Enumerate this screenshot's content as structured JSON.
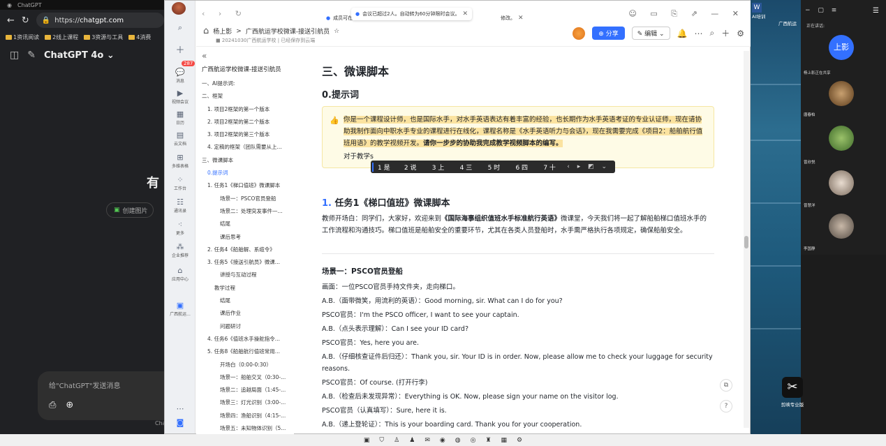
{
  "browser": {
    "tab_title": "ChatGPT",
    "url_prefix": "https://",
    "url_host": "chatgpt.com",
    "bookmarks": [
      "1资讯阅读",
      "2线上课程",
      "3资源与工具",
      "4消费"
    ],
    "model_label": "ChatGPT 4o",
    "hero_partial": "有",
    "create_image": "创建图片",
    "input_placeholder": "给\"ChatGPT\"发送消息",
    "footer_partial": "Cha"
  },
  "rail": {
    "badge": "287",
    "items": [
      "消息",
      "视频会议",
      "日历",
      "云文档",
      "多维表格",
      "工作台",
      "通讯录",
      "更多",
      "企业推荐",
      "应用中心",
      "广西航运..."
    ]
  },
  "doc": {
    "tabs": [
      {
        "label": "成员可在"
      },
      {
        "label": "会议已超过2人。自动转为60分钟限时会议。"
      },
      {
        "label": "修改。"
      }
    ],
    "breadcrumb_root": "杨上影",
    "breadcrumb_sep": ">",
    "title": "广西航运学校微课-接送引航员",
    "sub_folder": "20241030广西航运学校",
    "sub_status": "已经保存到云端",
    "share_label": "分享",
    "edit_label": "编辑"
  },
  "outline": {
    "title": "广西航运学校微课-接送引航员",
    "items": [
      {
        "label": "一、AI提示词:",
        "level": "l1"
      },
      {
        "label": "二、框架",
        "level": "l1"
      },
      {
        "label": "1. 项目2框架的第一个版本",
        "level": "l2"
      },
      {
        "label": "2. 项目2框架的第二个版本",
        "level": "l2"
      },
      {
        "label": "3. 项目2框架的第三个版本",
        "level": "l2"
      },
      {
        "label": "4. 定稿的框架（团队需要从上...",
        "level": "l2"
      },
      {
        "label": "三、微课脚本",
        "level": "l1"
      },
      {
        "label": "0.提示词",
        "level": "l2 act"
      },
      {
        "label": "1. 任务1《梯口值班》微课脚本",
        "level": "l2"
      },
      {
        "label": "场景一：PSCO官员登船",
        "level": "l3"
      },
      {
        "label": "场景二：处理突发事件—...",
        "level": "l3"
      },
      {
        "label": "结尾",
        "level": "l3"
      },
      {
        "label": "课后思考",
        "level": "l3"
      },
      {
        "label": "2. 任务4《船舶解、系缆令》",
        "level": "l2"
      },
      {
        "label": "3. 任务5《接送引航员》微课...",
        "level": "l2"
      },
      {
        "label": "讲授与互动过程",
        "level": "l3"
      },
      {
        "label": "教学过程",
        "level": "l3b"
      },
      {
        "label": "结尾",
        "level": "l3"
      },
      {
        "label": "课后作业",
        "level": "l3"
      },
      {
        "label": "问题研讨",
        "level": "l3"
      },
      {
        "label": "4. 任务6《值班水手操舵指令...",
        "level": "l2"
      },
      {
        "label": "5. 任务8《船舶航行值班常用...",
        "level": "l2"
      },
      {
        "label": "开场白（0:00-0:30）",
        "level": "l3"
      },
      {
        "label": "场景一：船舶交叉（0:30-...",
        "level": "l3"
      },
      {
        "label": "场景二：追越局面（1:45-...",
        "level": "l3"
      },
      {
        "label": "场景三：灯光识别（3:00-...",
        "level": "l3"
      },
      {
        "label": "场景四：渔船识别（4:15-...",
        "level": "l3"
      },
      {
        "label": "场景五：未知物体识别（5...",
        "level": "l3"
      }
    ]
  },
  "content": {
    "h_section": "三、微课脚本",
    "h_prompt": "0.提示词",
    "callout_hl": "你是一个课程设计师，也是国际水手，对水手英语表达有着丰富的经验，也长期作为水手英语考证的专业认证师，现在请协助我制作面向中职水手专业的课程进行在线化，课程名称是《水手英语听力与会话》，现在我需要完成《项目2：船舶航行值班用语》的教学视频开发。",
    "callout_bold": "请你一步步的协助我完成教学视频脚本的编写。",
    "callout_typing": "对于教学s",
    "ime_candidates": [
      "1 是",
      "2 说",
      "3 上",
      "4 三",
      "5 时",
      "6 四",
      "7 十"
    ],
    "task_num": "1.",
    "task_title": " 任务1《梯口值班》微课脚本",
    "intro_pre": "教师开场白：同学们，大家好，欢迎来到",
    "intro_bold": "《国际海事组织值班水手标准航行英语》",
    "intro_post": "微课堂，今天我们将一起了解船舶梯口值班水手的工作流程和沟通技巧。梯口值班是船舶安全的重要环节，尤其在各类人员登船时，水手需严格执行各项规定，确保船舶安全。",
    "scene_title": "场景一：PSCO官员登船",
    "lines": [
      "画面：一位PSCO官员手持文件夹，走向梯口。",
      "A.B.（面带微笑，用流利的英语）：Good morning, sir. What can I do for you?",
      "PSCO官员：I'm the PSCO officer, I want to see your captain.",
      "A.B.（点头表示理解）：Can I see your ID card?",
      "PSCO官员：Yes, here you are.",
      "A.B.（仔细核查证件后归还）：Thank you,  sir. Your ID is in order. Now, please allow me to check your luggage for security reasons.",
      "PSCO官员：Of course. (打开行李)",
      "A.B.（检查后未发现异常）：Everything is OK. Now, please sign your name on the visitor log.",
      "PSCO官员（认真填写）：Sure, here it is.",
      "A.B.（递上登轮证）：This is your boarding card. Thank you for your cooperation."
    ]
  },
  "meeting": {
    "title_partial": "正在讲话:",
    "host_initials": "上影",
    "participants": [
      "杨上影正在共享",
      "唐春柏",
      "曾欣悦",
      "曾慧洋",
      "李国静"
    ]
  },
  "desktop": {
    "icons": [
      "AI培训",
      "广西航运",
      "剪映专业版"
    ]
  }
}
